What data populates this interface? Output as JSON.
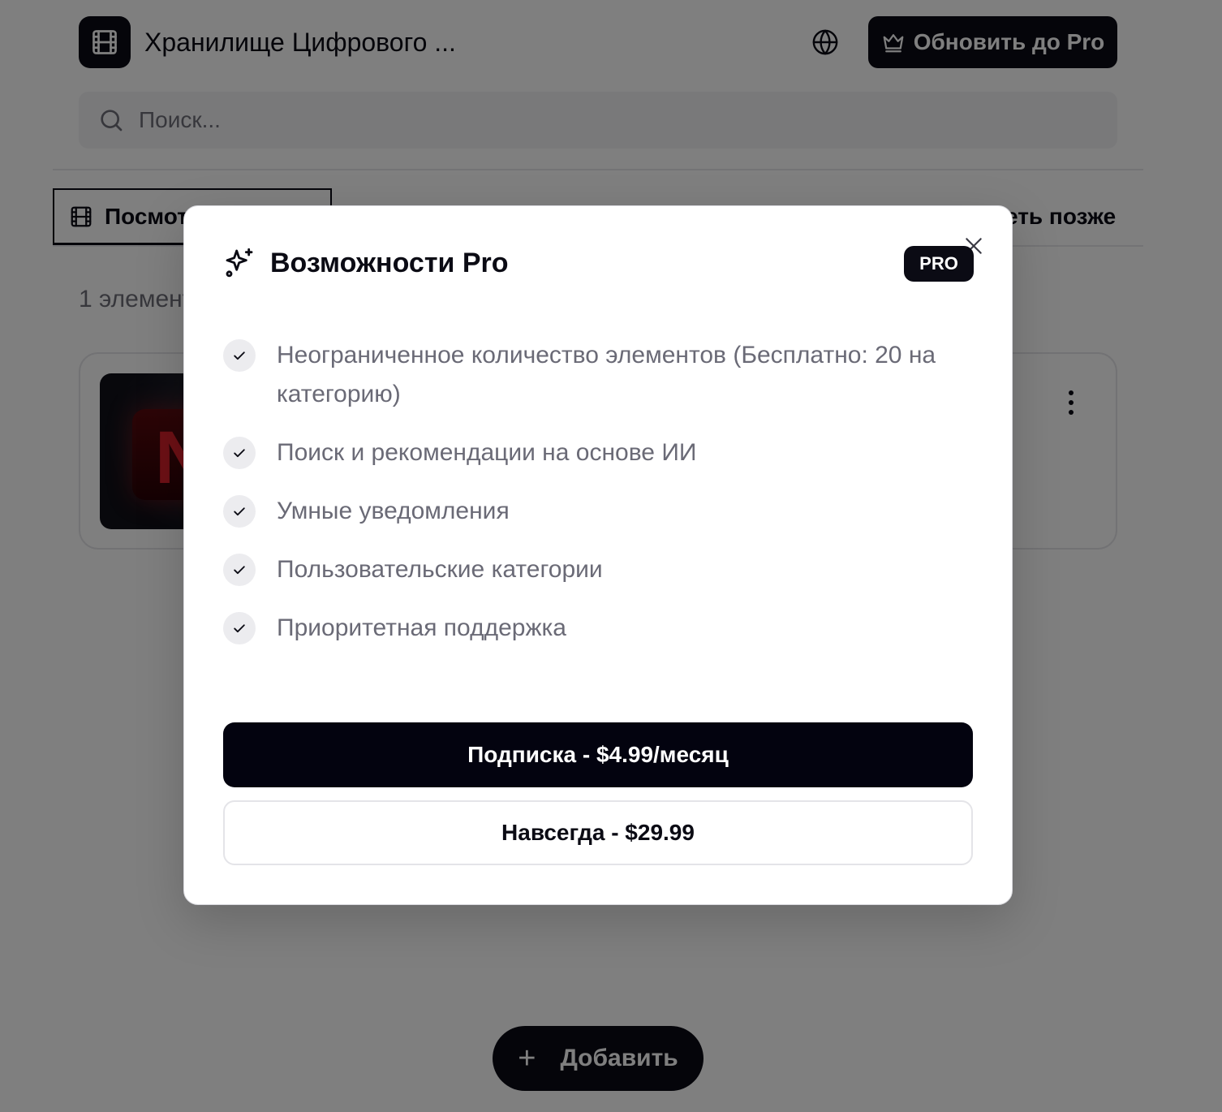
{
  "header": {
    "app_title": "Хранилище Цифрового ...",
    "upgrade_label": "Обновить до Pro"
  },
  "search": {
    "placeholder": "Поиск..."
  },
  "tabs": [
    {
      "label": "Посмотреть позже",
      "icon": "film-icon",
      "active": true
    },
    {
      "label": "",
      "icon": "grid-icon",
      "active": false
    },
    {
      "label": "",
      "icon": "bookmark-icon",
      "active": false
    },
    {
      "label": "Посмотреть позже",
      "icon": "clock-icon",
      "active": false
    }
  ],
  "item_count": "1 элемент",
  "fab": {
    "label": "Добавить"
  },
  "modal": {
    "title": "Возможности Pro",
    "badge": "PRO",
    "features": [
      "Неограниченное количество элементов (Бесплатно: 20 на категорию)",
      "Поиск и рекомендации на основе ИИ",
      "Умные уведомления",
      "Пользовательские категории",
      "Приоритетная поддержка"
    ],
    "subscribe_label": "Подписка - $4.99/месяц",
    "lifetime_label": "Навсегда - $29.99"
  },
  "colors": {
    "primary": "#0b0b14",
    "muted_text": "#6a6a76",
    "overlay": "rgba(0,0,0,0.5)",
    "thumb_accent": "#d8202a"
  }
}
